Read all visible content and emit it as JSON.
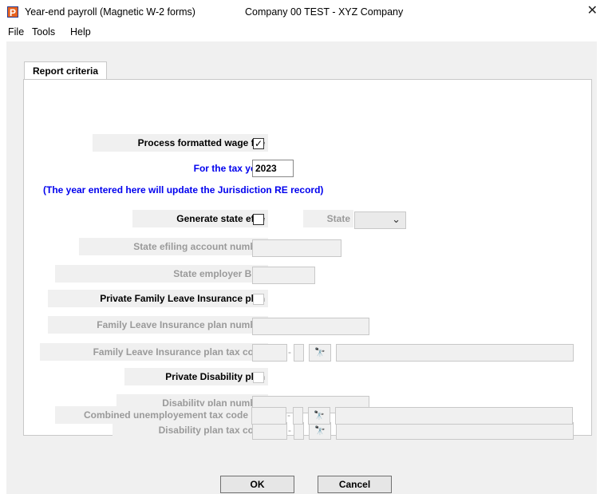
{
  "window": {
    "title": "Year-end payroll (Magnetic W-2 forms)",
    "company": "Company 00  TEST - XYZ Company",
    "close_glyph": "✕",
    "icon_letter": "P"
  },
  "menu": {
    "items": [
      "File",
      "Tools",
      "Help"
    ]
  },
  "tabs": [
    {
      "label": "Report criteria"
    }
  ],
  "form": {
    "process_formatted_wage_file": {
      "label": "Process formatted wage file",
      "checked_glyph": "✓"
    },
    "tax_year": {
      "label": "For the tax year",
      "value": "2023"
    },
    "note": "(The year entered here will update the Jurisdiction RE record)",
    "generate_state_efile": {
      "label": "Generate state efile"
    },
    "state": {
      "label": "State",
      "value": ""
    },
    "state_efiling_account_number": {
      "label": "State efiling account number"
    },
    "state_employer_ben": {
      "label": "State employer BEN"
    },
    "private_family_leave_plan": {
      "label": "Private Family Leave Insurance plan"
    },
    "family_leave_plan_number": {
      "label": "Family Leave Insurance plan number"
    },
    "family_leave_plan_tax_code": {
      "label": "Family Leave Insurance plan tax code"
    },
    "private_disability_plan": {
      "label": "Private Disability plan"
    },
    "disability_plan_number": {
      "label": "Disability plan number"
    },
    "disability_plan_tax_code": {
      "label": "Disability plan tax code"
    },
    "combined_unemployment_tax_code": {
      "label": "Combined unemployement tax code"
    },
    "dash": "-",
    "lookup_glyph": "🔍"
  },
  "buttons": {
    "ok": "OK",
    "cancel": "Cancel"
  },
  "colors": {
    "accent_blue": "#0000ee",
    "disabled_text": "#9a9a9a",
    "app_icon": "#e8621f"
  }
}
